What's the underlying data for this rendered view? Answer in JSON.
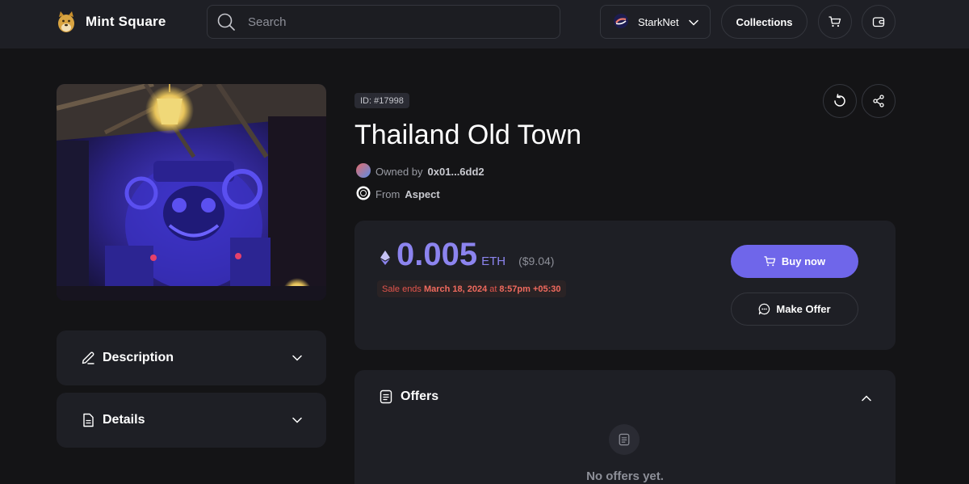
{
  "header": {
    "brand": "Mint Square",
    "search_placeholder": "Search",
    "network": "StarkNet",
    "collections_label": "Collections"
  },
  "nft": {
    "id_label": "ID: #17998",
    "title": "Thailand Old Town",
    "owned_prefix": "Owned by",
    "owner": "0x01...6dd2",
    "from_prefix": "From",
    "collection": "Aspect"
  },
  "price": {
    "value": "0.005",
    "unit": "ETH",
    "usd": "($9.04)",
    "sale_prefix": "Sale ends",
    "sale_date": "March 18, 2024",
    "sale_at": "at",
    "sale_time": "8:57pm +05:30",
    "buy_label": "Buy now",
    "offer_label": "Make Offer"
  },
  "sections": {
    "description": "Description",
    "details": "Details",
    "offers": "Offers",
    "no_offers": "No offers yet."
  },
  "colors": {
    "accent": "#6f66ea",
    "price": "#8c84ef",
    "background": "#141416",
    "card": "#1e1f25",
    "sale": "#e3554d"
  },
  "icons": [
    "search-icon",
    "starknet-icon",
    "chevron-down-icon",
    "cart-icon",
    "wallet-icon",
    "refresh-icon",
    "share-icon",
    "ethereum-icon",
    "chat-icon",
    "pencil-icon",
    "document-icon",
    "chevron-up-icon"
  ]
}
